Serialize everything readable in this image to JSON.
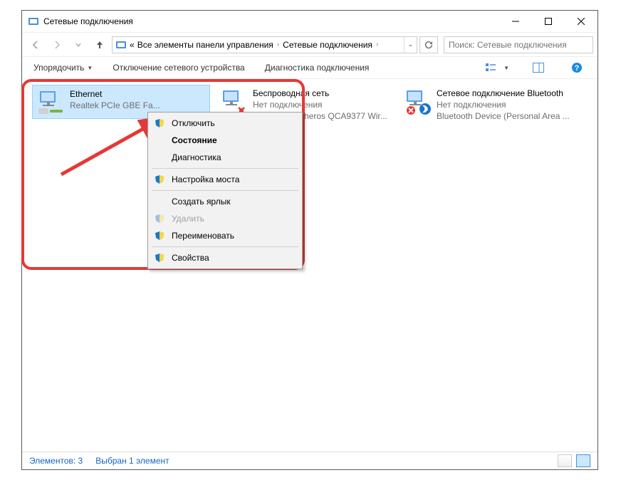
{
  "window": {
    "title": "Сетевые подключения"
  },
  "breadcrumb": {
    "prefix": "«",
    "part1": "Все элементы панели управления",
    "part2": "Сетевые подключения"
  },
  "search": {
    "placeholder": "Поиск: Сетевые подключения"
  },
  "cmdbar": {
    "organize": "Упорядочить",
    "disable": "Отключение сетевого устройства",
    "diag": "Диагностика подключения"
  },
  "connections": {
    "ethernet": {
      "name": "Ethernet",
      "status": "",
      "device": "Realtek PCIe GBE Fa..."
    },
    "wifi": {
      "name": "Беспроводная сеть",
      "status": "Нет подключения",
      "device": "Qualcomm Atheros QCA9377 Wir..."
    },
    "bt": {
      "name": "Сетевое подключение Bluetooth",
      "status": "Нет подключения",
      "device": "Bluetooth Device (Personal Area ..."
    }
  },
  "context_menu": {
    "disable": "Отключить",
    "status": "Состояние",
    "diag": "Диагностика",
    "bridge": "Настройка моста",
    "shortcut": "Создать ярлык",
    "delete": "Удалить",
    "rename": "Переименовать",
    "properties": "Свойства"
  },
  "statusbar": {
    "items": "Элементов: 3",
    "selected": "Выбран 1 элемент"
  }
}
